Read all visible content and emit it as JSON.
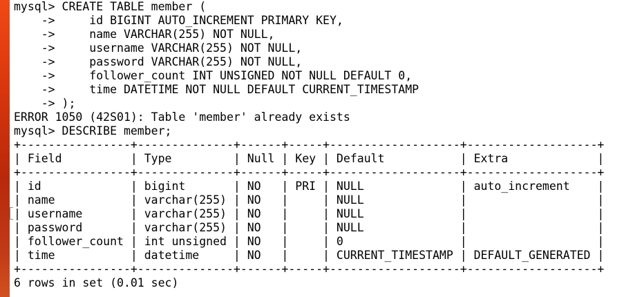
{
  "terminal": {
    "lines": [
      "mysql> CREATE TABLE member (",
      "    ->     id BIGINT AUTO_INCREMENT PRIMARY KEY,",
      "    ->     name VARCHAR(255) NOT NULL,",
      "    ->     username VARCHAR(255) NOT NULL,",
      "    ->     password VARCHAR(255) NOT NULL,",
      "    ->     follower_count INT UNSIGNED NOT NULL DEFAULT 0,",
      "    ->     time DATETIME NOT NULL DEFAULT CURRENT_TIMESTAMP",
      "    -> );",
      "ERROR 1050 (42S01): Table 'member' already exists",
      "mysql> DESCRIBE member;",
      "+----------------+--------------+------+-----+-------------------+-------------------+",
      "| Field          | Type         | Null | Key | Default           | Extra             |",
      "+----------------+--------------+------+-----+-------------------+-------------------+",
      "| id             | bigint       | NO   | PRI | NULL              | auto_increment    |",
      "| name           | varchar(255) | NO   |     | NULL              |                   |",
      "| username       | varchar(255) | NO   |     | NULL              |                   |",
      "| password       | varchar(255) | NO   |     | NULL              |                   |",
      "| follower_count | int unsigned | NO   |     | 0                 |                   |",
      "| time           | datetime     | NO   |     | CURRENT_TIMESTAMP | DEFAULT_GENERATED |",
      "+----------------+--------------+------+-----+-------------------+-------------------+",
      "6 rows in set (0.01 sec)"
    ]
  }
}
